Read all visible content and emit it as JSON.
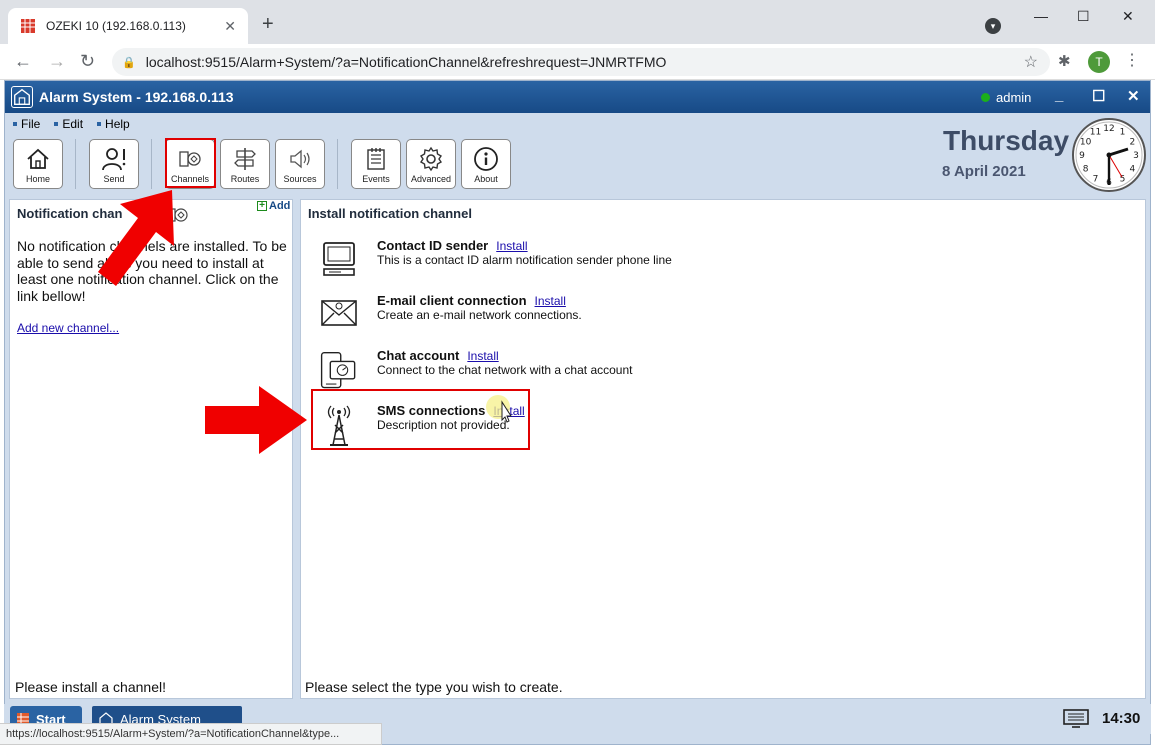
{
  "browser": {
    "tab_title": "OZEKI 10 (192.168.0.113)",
    "tab_close": "✕",
    "new_tab": "+",
    "url": "localhost:9515/Alarm+System/?a=NotificationChannel&refreshrequest=JNMRTFMO",
    "profile_initial": "T",
    "status_url": "https://localhost:9515/Alarm+System/?a=NotificationChannel&type...",
    "icons": [
      "back-icon",
      "forward-icon",
      "reload-icon",
      "lock-icon",
      "star-icon",
      "extensions-icon",
      "menu-icon"
    ]
  },
  "app": {
    "title": "Alarm System - 192.168.0.113",
    "user": "admin",
    "user_status_color": "#1bb01b",
    "title_color": "#174a86",
    "menu": [
      "File",
      "Edit",
      "Help"
    ],
    "toolbar": [
      {
        "label": "Home",
        "icon": "home-icon"
      },
      {
        "label": "Send",
        "icon": "send-icon"
      },
      {
        "label": "Channels",
        "icon": "channels-icon"
      },
      {
        "label": "Routes",
        "icon": "routes-icon"
      },
      {
        "label": "Sources",
        "icon": "sources-icon"
      },
      {
        "label": "Events",
        "icon": "events-icon"
      },
      {
        "label": "Advanced",
        "icon": "gear-icon"
      },
      {
        "label": "About",
        "icon": "info-icon"
      }
    ],
    "day": "Thursday",
    "date": "8 April 2021",
    "clock_numbers": [
      "12",
      "1",
      "2",
      "3",
      "4",
      "5",
      "6",
      "7",
      "8",
      "9",
      "10",
      "11"
    ]
  },
  "left_panel": {
    "title": "Notification chan",
    "add_label": "Add",
    "message": "No notification channels are installed. To be able to send alerts you need to install at least one notification channel. Click on the link bellow!",
    "link": "Add new channel...",
    "status": "Please install a channel!"
  },
  "right_panel": {
    "title": "Install notification channel",
    "channels": [
      {
        "name": "Contact ID sender",
        "action": "Install",
        "description": "This is a contact ID alarm notification sender phone line",
        "icon": "phone-line-icon"
      },
      {
        "name": "E-mail client connection",
        "action": "Install",
        "description": "Create an e-mail network connections.",
        "icon": "email-icon"
      },
      {
        "name": "Chat account",
        "action": "Install",
        "description": "Connect to the chat network with a chat account",
        "icon": "chat-icon"
      },
      {
        "name": "SMS connections",
        "action": "Install",
        "description": "Description not provided.",
        "icon": "antenna-icon"
      }
    ],
    "status": "Please select the type you wish to create."
  },
  "taskbar": {
    "start": "Start",
    "item": "Alarm System",
    "time": "14:30"
  },
  "colors": {
    "highlight": "#e00000",
    "accent": "#2a63a3"
  }
}
